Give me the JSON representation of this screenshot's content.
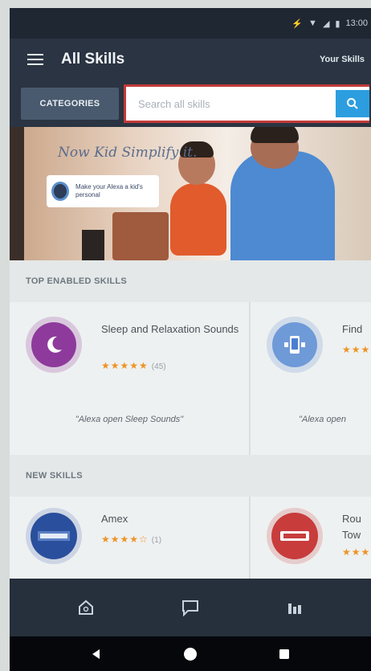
{
  "status_bar": {
    "time": "13:00"
  },
  "app_bar": {
    "title": "All Skills",
    "your_skills_label": "Your Skills"
  },
  "search": {
    "categories_label": "CATEGORIES",
    "placeholder": "Search all skills"
  },
  "banner": {
    "headline": "Now Kid Simplify it.",
    "card_text": "Make your Alexa a kid's personal",
    "colors": {
      "adult_shirt": "#4d8ad2",
      "child_shirt": "#e15b2c"
    }
  },
  "top_enabled": {
    "header": "TOP ENABLED SKILLS",
    "cards": [
      {
        "name": "Sleep and Relaxation Sounds",
        "stars": "★★★★★",
        "rating_count": "(45)",
        "quote": "\"Alexa open Sleep Sounds\"",
        "icon": "moon-icon",
        "icon_color": "#8e3a9c"
      },
      {
        "name": "Find",
        "stars": "★★★",
        "rating_count": "",
        "quote": "\"Alexa open",
        "icon": "phone-finder-icon",
        "icon_color": "#4c7fd0"
      }
    ]
  },
  "new_skills": {
    "header": "NEW SKILLS",
    "cards": [
      {
        "name": "Amex",
        "stars": "★★★★☆",
        "rating_count": "(1)",
        "icon": "amex-icon",
        "icon_color": "#2a4f9c"
      },
      {
        "name": "Rou Tow",
        "stars": "★★★",
        "rating_count": "",
        "icon": "red-card-icon",
        "icon_color": "#c83c3c"
      }
    ]
  },
  "bottom_nav": {
    "items": [
      "home-icon",
      "chat-icon",
      "activity-icon"
    ]
  }
}
